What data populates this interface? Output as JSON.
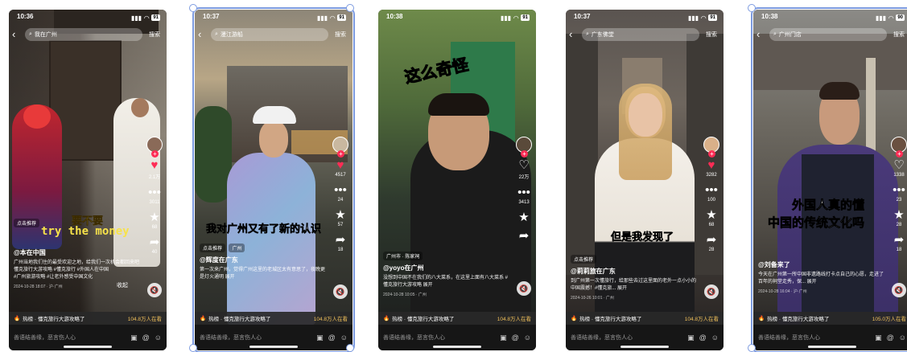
{
  "common": {
    "search_button": "搜索",
    "comment_placeholder": "善语结善缘，恶言伤人心",
    "hot_prefix": "热榜 · 懂克旅行大游攻略了",
    "icons": [
      "back-arrow-icon",
      "search-icon",
      "heart-icon",
      "comment-icon",
      "star-icon",
      "share-icon",
      "mute-icon",
      "image-icon",
      "at-icon",
      "emoji-icon",
      "fire-icon"
    ]
  },
  "phones": [
    {
      "time": "10:36",
      "battery": "91",
      "search": "我在广州",
      "overlay_line1": "要不要",
      "overlay_line2": "try the money",
      "chip": "点击推荐",
      "author": "@本在中国",
      "desc": "广州当地我们住的最受欢迎之地，给我们一次机会都回来吧 懂克旅行大游攻略 #懂克旅行 #外国人在中国",
      "desc2": "#广州旅游攻略 #让老外感受中国文化",
      "collapse": "收起",
      "meta": "2024-10-28 18:07 · 沪·广州",
      "hot_count": "104.8万人在看",
      "likes": "2.1万",
      "comments": "3011",
      "stars": "68",
      "shares": "40"
    },
    {
      "time": "10:37",
      "battery": "91",
      "search": "漫江游船",
      "overlay_line1": "我对广州又有了新的认识",
      "chip": "点击推荐",
      "location": "广州",
      "author": "@辉度在广东",
      "desc": "第一次来广州，觉得广州这里的老城区太有意思了，夜晚更是灯火通明 展开",
      "meta": "",
      "hot_count": "104.8万人在看",
      "likes": "4517",
      "comments": "24",
      "stars": "57",
      "shares": "18"
    },
    {
      "time": "10:38",
      "battery": "91",
      "overlay_line1": "这么奇怪",
      "location": "广州市 · 陈家祠",
      "author": "@yoyo在广州",
      "desc": "没想到中国不在我们的八大菜系，在这里上面有八大菜系 #懂克旅行大游攻略 展开",
      "meta": "2024-10-28 10:05 · 广州",
      "hot_count": "104.8万人在看",
      "likes": "22万",
      "comments": "3413",
      "stars": "",
      "shares": ""
    },
    {
      "time": "10:37",
      "battery": "91",
      "search": "广东佛堂",
      "overlay_line1": "但是我发现了",
      "chip": "点击推荐",
      "author": "@莉莉旅在广东",
      "desc": "到广州第一次懂旅行，给那些去过这里面的老外一点小小的中国震撼！#懂克旅... 展开",
      "meta": "2024-10-26 10:01 · 广州",
      "hot_count": "104.8万人在看",
      "likes": "3282",
      "comments": "100",
      "stars": "68",
      "shares": "28"
    },
    {
      "time": "10:38",
      "battery": "90",
      "search": "广州门店",
      "overlay_line1": "外国人真的懂",
      "overlay_line2": "中国的传统文化吗",
      "author": "@刘备来了",
      "desc": "今天在广州第一所中国非遗路线打卡点自己的心愿，走进了百年的祠堂走秀，保... 展开",
      "meta": "2024-10-28 16:04 · 沪·广州",
      "hot_count": "105.0万人在看",
      "likes": "1338",
      "comments": "23",
      "stars": "28",
      "shares": "18"
    }
  ]
}
